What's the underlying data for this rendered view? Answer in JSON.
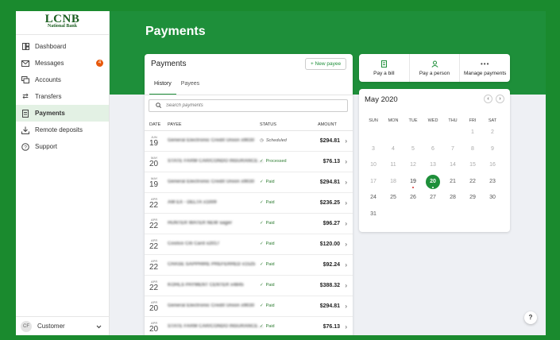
{
  "brand": {
    "name": "LCNB",
    "tagline": "National Bank"
  },
  "sidebar": {
    "items": [
      {
        "label": "Dashboard",
        "icon": "dashboard-icon"
      },
      {
        "label": "Messages",
        "icon": "mail-icon",
        "badge": "4"
      },
      {
        "label": "Accounts",
        "icon": "accounts-icon"
      },
      {
        "label": "Transfers",
        "icon": "transfer-icon"
      },
      {
        "label": "Payments",
        "icon": "payments-icon",
        "active": true
      },
      {
        "label": "Remote deposits",
        "icon": "download-icon"
      },
      {
        "label": "Support",
        "icon": "help-circle-icon"
      }
    ],
    "user": {
      "initials": "CF",
      "name": "Customer"
    }
  },
  "header": {
    "title": "Payments"
  },
  "payments": {
    "title": "Payments",
    "new_payee": "+ New payee",
    "tabs": [
      "History",
      "Payees"
    ],
    "search_placeholder": "Search payments",
    "columns": {
      "date": "DATE",
      "payee": "PAYEE",
      "status": "STATUS",
      "amount": "AMOUNT"
    },
    "rows": [
      {
        "month": "JUN",
        "day": "19",
        "payee": "General Electronic Credit Union x9030",
        "status": "Scheduled",
        "amount": "$294.81"
      },
      {
        "month": "MAY",
        "day": "20",
        "payee": "STATE FARM CAR/CONDO INSURANCE ...",
        "status": "Processed",
        "amount": "$76.13"
      },
      {
        "month": "MAY",
        "day": "19",
        "payee": "General Electronic Credit Union x9030",
        "status": "Paid",
        "amount": "$294.81"
      },
      {
        "month": "APR",
        "day": "22",
        "payee": "AM EX - DELTA x1009",
        "status": "Paid",
        "amount": "$236.25"
      },
      {
        "month": "APR",
        "day": "22",
        "payee": "HUNTER WATER NEW sager",
        "status": "Paid",
        "amount": "$96.27"
      },
      {
        "month": "APR",
        "day": "22",
        "payee": "Costco Citi Card x2017",
        "status": "Paid",
        "amount": "$120.00"
      },
      {
        "month": "APR",
        "day": "22",
        "payee": "CHASE SAPPHIRE PREFERRED x1525",
        "status": "Paid",
        "amount": "$92.24"
      },
      {
        "month": "APR",
        "day": "22",
        "payee": "KOHLS PAYMENT CENTER x4845",
        "status": "Paid",
        "amount": "$388.32"
      },
      {
        "month": "APR",
        "day": "20",
        "payee": "General Electronic Credit Union x9030",
        "status": "Paid",
        "amount": "$294.81"
      },
      {
        "month": "APR",
        "day": "20",
        "payee": "STATE FARM CAR/CONDO INSURANCE ...",
        "status": "Paid",
        "amount": "$76.13"
      }
    ]
  },
  "actions": [
    {
      "label": "Pay a bill",
      "icon": "bill-icon"
    },
    {
      "label": "Pay a person",
      "icon": "person-icon"
    },
    {
      "label": "Manage payments",
      "icon": "more-icon"
    }
  ],
  "calendar": {
    "title": "May 2020",
    "days_of_week": [
      "SUN",
      "MON",
      "TUE",
      "WED",
      "THU",
      "FRI",
      "SAT"
    ],
    "first_weekday": 5,
    "days_in_month": 31,
    "today": 20,
    "marked": [
      19,
      20
    ]
  },
  "help": "?"
}
